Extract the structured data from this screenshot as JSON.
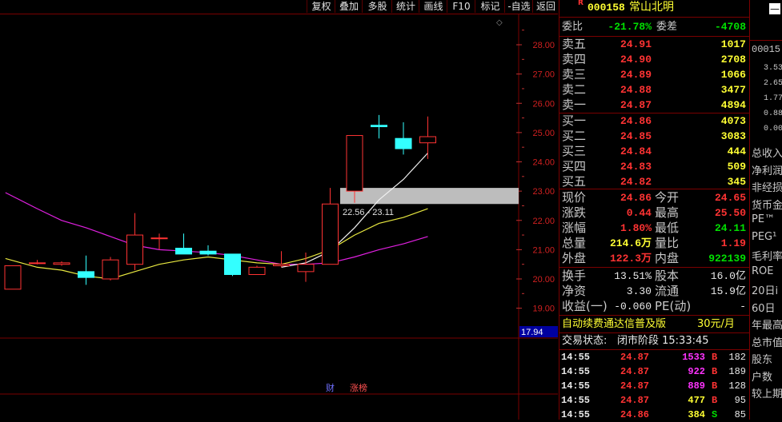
{
  "toolbar": {
    "items": [
      "复权",
      "叠加",
      "多股",
      "统计",
      "画线",
      "F10",
      "标记",
      "-自选",
      "返回"
    ]
  },
  "chart_data": {
    "type": "candlestick",
    "y_ticks": [
      "28.00",
      "27.00",
      "26.00",
      "25.00",
      "24.00",
      "23.00",
      "22.00",
      "21.00",
      "20.00",
      "19.00"
    ],
    "ylim": [
      18.0,
      28.8
    ],
    "last_price_label": "17.94",
    "range_label": "22.56 - 23.11",
    "highlight_band": [
      22.56,
      23.11
    ],
    "bottom_labels": [
      "财",
      "涨榜"
    ],
    "candles": [
      {
        "o": 19.65,
        "h": 20.45,
        "l": 19.65,
        "c": 20.45
      },
      {
        "o": 20.55,
        "h": 20.65,
        "l": 20.5,
        "c": 20.55
      },
      {
        "o": 20.5,
        "h": 20.6,
        "l": 20.45,
        "c": 20.55
      },
      {
        "o": 20.25,
        "h": 20.8,
        "l": 19.8,
        "c": 20.05
      },
      {
        "o": 20.0,
        "h": 20.75,
        "l": 19.95,
        "c": 20.65
      },
      {
        "o": 20.5,
        "h": 22.25,
        "l": 20.3,
        "c": 21.5
      },
      {
        "o": 21.4,
        "h": 21.55,
        "l": 21.0,
        "c": 21.4
      },
      {
        "o": 21.05,
        "h": 21.55,
        "l": 20.95,
        "c": 20.85
      },
      {
        "o": 20.95,
        "h": 21.15,
        "l": 20.8,
        "c": 20.85
      },
      {
        "o": 20.85,
        "h": 20.85,
        "l": 20.1,
        "c": 20.15
      },
      {
        "o": 20.15,
        "h": 20.45,
        "l": 20.15,
        "c": 20.4
      },
      {
        "o": 20.45,
        "h": 20.95,
        "l": 20.4,
        "c": 20.5
      },
      {
        "o": 20.25,
        "h": 20.9,
        "l": 19.9,
        "c": 20.5
      },
      {
        "o": 20.5,
        "h": 23.11,
        "l": 20.5,
        "c": 22.56
      },
      {
        "o": 23.0,
        "h": 24.9,
        "l": 22.6,
        "c": 24.9
      },
      {
        "o": 25.25,
        "h": 25.6,
        "l": 24.8,
        "c": 25.2
      },
      {
        "o": 24.8,
        "h": 25.35,
        "l": 24.25,
        "c": 24.45
      },
      {
        "o": 24.65,
        "h": 25.55,
        "l": 24.1,
        "c": 24.86
      }
    ],
    "ma_white": [
      {
        "i": 11,
        "v": 20.4
      },
      {
        "i": 12,
        "v": 20.55
      },
      {
        "i": 13,
        "v": 20.95
      },
      {
        "i": 14,
        "v": 21.75
      },
      {
        "i": 15,
        "v": 22.7
      },
      {
        "i": 16,
        "v": 23.4
      },
      {
        "i": 17,
        "v": 24.3
      }
    ],
    "ma_yellow": [
      {
        "i": -0.3,
        "v": 20.7
      },
      {
        "i": 1,
        "v": 20.4
      },
      {
        "i": 2,
        "v": 20.3
      },
      {
        "i": 3,
        "v": 20.1
      },
      {
        "i": 4,
        "v": 20.0
      },
      {
        "i": 5,
        "v": 20.25
      },
      {
        "i": 6,
        "v": 20.5
      },
      {
        "i": 7,
        "v": 20.65
      },
      {
        "i": 8,
        "v": 20.75
      },
      {
        "i": 9,
        "v": 20.65
      },
      {
        "i": 10,
        "v": 20.55
      },
      {
        "i": 11,
        "v": 20.5
      },
      {
        "i": 12,
        "v": 20.7
      },
      {
        "i": 13,
        "v": 21.0
      },
      {
        "i": 14,
        "v": 21.5
      },
      {
        "i": 15,
        "v": 21.9
      },
      {
        "i": 16,
        "v": 22.1
      },
      {
        "i": 17,
        "v": 22.4
      }
    ],
    "ma_magenta": [
      {
        "i": -0.3,
        "v": 22.95
      },
      {
        "i": 1,
        "v": 22.4
      },
      {
        "i": 2,
        "v": 22.0
      },
      {
        "i": 3,
        "v": 21.75
      },
      {
        "i": 4,
        "v": 21.45
      },
      {
        "i": 5,
        "v": 21.15
      },
      {
        "i": 6,
        "v": 21.0
      },
      {
        "i": 7,
        "v": 20.95
      },
      {
        "i": 8,
        "v": 20.9
      },
      {
        "i": 9,
        "v": 20.8
      },
      {
        "i": 10,
        "v": 20.65
      },
      {
        "i": 11,
        "v": 20.5
      },
      {
        "i": 12,
        "v": 20.5
      },
      {
        "i": 13,
        "v": 20.55
      },
      {
        "i": 14,
        "v": 20.75
      },
      {
        "i": 15,
        "v": 21.0
      },
      {
        "i": 16,
        "v": 21.2
      },
      {
        "i": 17,
        "v": 21.45
      }
    ]
  },
  "quote": {
    "badge": "R",
    "code": "000158",
    "name": "常山北明",
    "webi_label": "委比",
    "webi_value": "-21.78%",
    "weicha_label": "委差",
    "weicha_value": "-4708",
    "sells": [
      {
        "label": "卖五",
        "price": "24.91",
        "vol": "1017"
      },
      {
        "label": "卖四",
        "price": "24.90",
        "vol": "2708"
      },
      {
        "label": "卖三",
        "price": "24.89",
        "vol": "1066"
      },
      {
        "label": "卖二",
        "price": "24.88",
        "vol": "3477"
      },
      {
        "label": "卖一",
        "price": "24.87",
        "vol": "4894"
      }
    ],
    "buys": [
      {
        "label": "买一",
        "price": "24.86",
        "vol": "4073"
      },
      {
        "label": "买二",
        "price": "24.85",
        "vol": "3083"
      },
      {
        "label": "买三",
        "price": "24.84",
        "vol": "444"
      },
      {
        "label": "买四",
        "price": "24.83",
        "vol": "509"
      },
      {
        "label": "买五",
        "price": "24.82",
        "vol": "345"
      }
    ],
    "stats": [
      {
        "l1": "现价",
        "v1": "24.86",
        "c1": "red",
        "l2": "今开",
        "v2": "24.65",
        "c2": "red"
      },
      {
        "l1": "涨跌",
        "v1": "0.44",
        "c1": "red",
        "l2": "最高",
        "v2": "25.50",
        "c2": "red"
      },
      {
        "l1": "涨幅",
        "v1": "1.80%",
        "c1": "red",
        "l2": "最低",
        "v2": "24.11",
        "c2": "green"
      },
      {
        "l1": "总量",
        "v1": "214.6万",
        "c1": "yellow",
        "l2": "量比",
        "v2": "1.19",
        "c2": "red"
      },
      {
        "l1": "外盘",
        "v1": "122.3万",
        "c1": "red",
        "l2": "内盘",
        "v2": "922139",
        "c2": "green"
      }
    ],
    "stats2": [
      {
        "l1": "换手",
        "v1": "13.51%",
        "l2": "股本",
        "v2": "16.0亿"
      },
      {
        "l1": "净资",
        "v1": "3.30",
        "l2": "流通",
        "v2": "15.9亿"
      },
      {
        "l1": "收益(一)",
        "v1": "-0.060",
        "l2": "PE(动)",
        "v2": "-"
      }
    ],
    "promo_text": "自动续费通达信普及版",
    "promo_price": "30元/月",
    "status_label": "交易状态:",
    "status_value": "闭市阶段 15:33:45",
    "ticks": [
      {
        "t": "14:55",
        "p": "24.87",
        "v": "1533",
        "vc": "magenta",
        "bs": "B",
        "bc": "red",
        "n": "182"
      },
      {
        "t": "14:55",
        "p": "24.87",
        "v": "922",
        "vc": "magenta",
        "bs": "B",
        "bc": "red",
        "n": "189"
      },
      {
        "t": "14:55",
        "p": "24.87",
        "v": "889",
        "vc": "magenta",
        "bs": "B",
        "bc": "red",
        "n": "128"
      },
      {
        "t": "14:55",
        "p": "24.87",
        "v": "477",
        "vc": "yellow",
        "bs": "B",
        "bc": "red",
        "n": "95"
      },
      {
        "t": "14:55",
        "p": "24.86",
        "v": "384",
        "vc": "yellow",
        "bs": "S",
        "bc": "green",
        "n": "85"
      }
    ]
  },
  "side": {
    "code": "00015",
    "nums": [
      "3.53",
      "2.65",
      "1.77",
      "0.88",
      "0.00"
    ],
    "labels": [
      "总收入",
      "净利润",
      "非经损",
      "货币金",
      "PE™",
      "PEG¹",
      "毛利率",
      "ROE",
      "20日i",
      "60日",
      "年最高",
      "总市值",
      "股东",
      "户数",
      "较上期"
    ]
  },
  "colors": {
    "up": "#ff3333",
    "down": "#33ffff",
    "grid": "#7a0000"
  }
}
